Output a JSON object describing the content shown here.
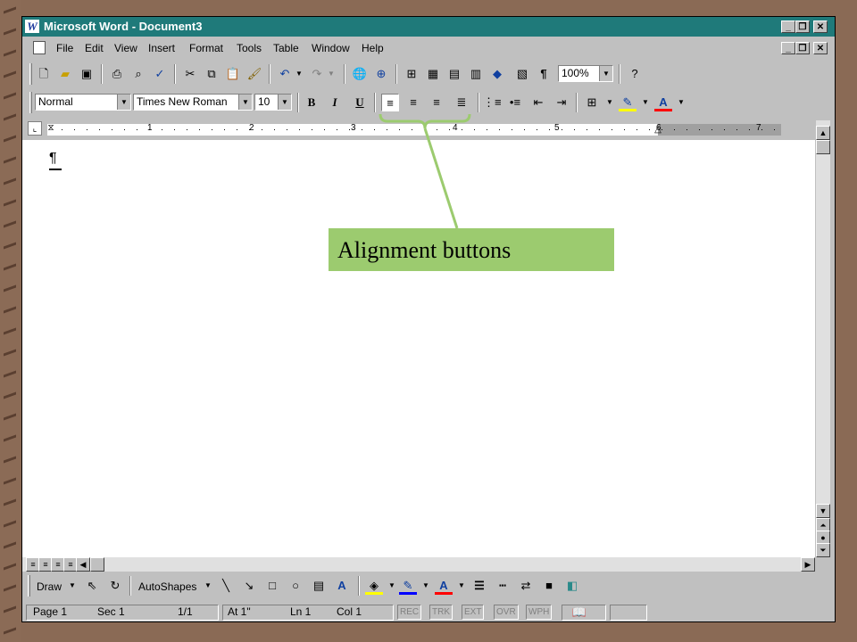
{
  "window": {
    "title": "Microsoft Word - Document3",
    "app_icon_letter": "W"
  },
  "window_buttons": [
    "minimize-icon",
    "restore-icon",
    "close-icon"
  ],
  "menubar": {
    "items": [
      "File",
      "Edit",
      "View",
      "Insert",
      "Format",
      "Tools",
      "Table",
      "Window",
      "Help"
    ]
  },
  "standard_toolbar": {
    "zoom_value": "100%",
    "buttons": [
      "new-icon",
      "open-icon",
      "save-icon",
      "print-icon",
      "print-preview-icon",
      "spelling-icon",
      "cut-icon",
      "copy-icon",
      "paste-icon",
      "format-painter-icon",
      "undo-icon",
      "redo-icon",
      "insert-hyperlink-icon",
      "web-toolbar-icon",
      "tables-borders-icon",
      "insert-table-icon",
      "insert-excel-icon",
      "columns-icon",
      "drawing-icon",
      "document-map-icon",
      "show-hide-icon",
      "help-icon"
    ]
  },
  "formatting_toolbar": {
    "style": "Normal",
    "font": "Times New Roman",
    "size": "10",
    "bold": "B",
    "italic": "I",
    "underline": "U",
    "alignment_buttons": [
      "align-left-icon",
      "center-icon",
      "align-right-icon",
      "justify-icon"
    ]
  },
  "ruler": {
    "numbers": [
      "1",
      "2",
      "3",
      "4",
      "5",
      "6",
      "7"
    ]
  },
  "document": {
    "paragraph_mark": "¶"
  },
  "drawing_toolbar": {
    "draw_label": "Draw",
    "autoshapes_label": "AutoShapes"
  },
  "status_bar": {
    "page": "Page 1",
    "sec": "Sec 1",
    "pages": "1/1",
    "at": "At 1\"",
    "ln": "Ln 1",
    "col": "Col 1",
    "rec": "REC",
    "trk": "TRK",
    "ext": "EXT",
    "ovr": "OVR",
    "wph": "WPH"
  },
  "annotation": {
    "label": "Alignment buttons",
    "color": "#9ccb6f"
  }
}
